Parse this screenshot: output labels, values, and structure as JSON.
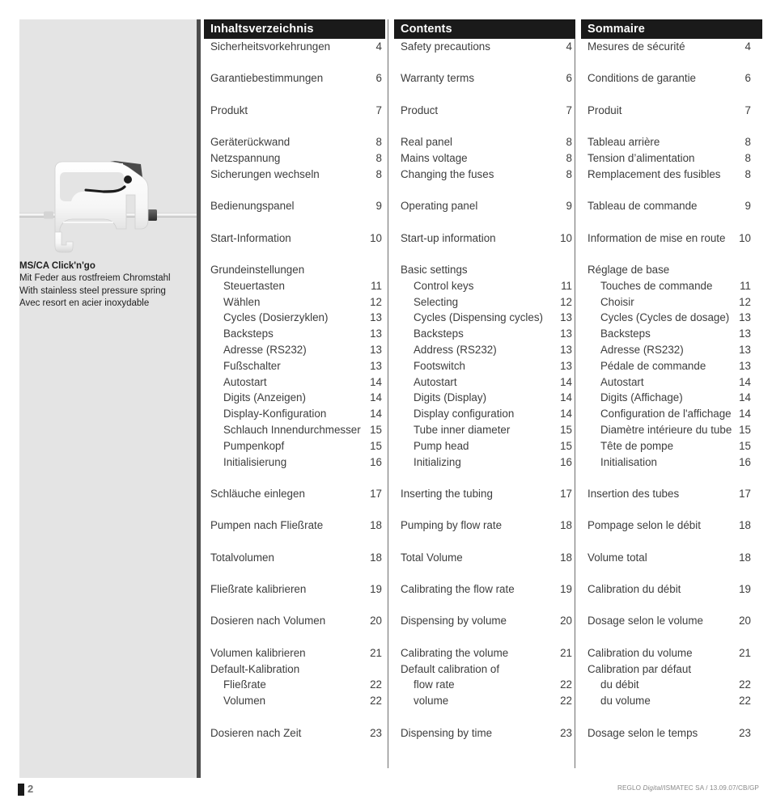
{
  "left_panel": {
    "image_alt": "ms-ca-click-n-go-cartridge",
    "caption": {
      "title": "MS/CA Click'n'go",
      "line_de": "Mit Feder aus rostfreiem Chromstahl",
      "line_en": "With stainless steel pressure spring",
      "line_fr": "Avec resort en acier inoxydable"
    }
  },
  "columns": [
    {
      "id": "de",
      "heading": "Inhaltsverzeichnis",
      "entries": [
        {
          "label": "Sicherheitsvorkehrungen",
          "page": "4",
          "sub": false,
          "gap_after": true
        },
        {
          "label": "Garantiebestimmungen",
          "page": "6",
          "sub": false,
          "gap_after": true
        },
        {
          "label": "Produkt",
          "page": "7",
          "sub": false,
          "gap_after": true
        },
        {
          "label": "Geräterückwand",
          "page": "8",
          "sub": false,
          "gap_after": false
        },
        {
          "label": "Netzspannung",
          "page": "8",
          "sub": false,
          "gap_after": false
        },
        {
          "label": "Sicherungen wechseln",
          "page": "8",
          "sub": false,
          "gap_after": true
        },
        {
          "label": "Bedienungspanel",
          "page": "9",
          "sub": false,
          "gap_after": true
        },
        {
          "label": "Start-Information",
          "page": "10",
          "sub": false,
          "gap_after": true
        },
        {
          "label": "Grundeinstellungen",
          "page": "",
          "sub": false,
          "gap_after": false
        },
        {
          "label": "Steuertasten",
          "page": "11",
          "sub": true,
          "gap_after": false
        },
        {
          "label": "Wählen",
          "page": "12",
          "sub": true,
          "gap_after": false
        },
        {
          "label": "Cycles (Dosierzyklen)",
          "page": "13",
          "sub": true,
          "gap_after": false
        },
        {
          "label": "Backsteps",
          "page": "13",
          "sub": true,
          "gap_after": false
        },
        {
          "label": "Adresse (RS232)",
          "page": "13",
          "sub": true,
          "gap_after": false
        },
        {
          "label": "Fußschalter",
          "page": "13",
          "sub": true,
          "gap_after": false
        },
        {
          "label": "Autostart",
          "page": "14",
          "sub": true,
          "gap_after": false
        },
        {
          "label": "Digits (Anzeigen)",
          "page": "14",
          "sub": true,
          "gap_after": false
        },
        {
          "label": "Display-Konfiguration",
          "page": "14",
          "sub": true,
          "gap_after": false
        },
        {
          "label": "Schlauch Innendurchmesser",
          "page": "15",
          "sub": true,
          "gap_after": false
        },
        {
          "label": "Pumpenkopf",
          "page": "15",
          "sub": true,
          "gap_after": false
        },
        {
          "label": "Initialisierung",
          "page": "16",
          "sub": true,
          "gap_after": true
        },
        {
          "label": "Schläuche einlegen",
          "page": "17",
          "sub": false,
          "gap_after": true
        },
        {
          "label": "Pumpen nach Fließrate",
          "page": "18",
          "sub": false,
          "gap_after": true
        },
        {
          "label": "Totalvolumen",
          "page": "18",
          "sub": false,
          "gap_after": true
        },
        {
          "label": "Fließrate kalibrieren",
          "page": "19",
          "sub": false,
          "gap_after": true
        },
        {
          "label": "Dosieren nach Volumen",
          "page": "20",
          "sub": false,
          "gap_after": true
        },
        {
          "label": "Volumen kalibrieren",
          "page": "21",
          "sub": false,
          "gap_after": false
        },
        {
          "label": "Default-Kalibration",
          "page": "",
          "sub": false,
          "gap_after": false
        },
        {
          "label": "Fließrate",
          "page": "22",
          "sub": true,
          "gap_after": false
        },
        {
          "label": "Volumen",
          "page": "22",
          "sub": true,
          "gap_after": true
        },
        {
          "label": "Dosieren nach Zeit",
          "page": "23",
          "sub": false,
          "gap_after": false
        }
      ]
    },
    {
      "id": "en",
      "heading": "Contents",
      "entries": [
        {
          "label": "Safety precautions",
          "page": "4",
          "sub": false,
          "gap_after": true
        },
        {
          "label": "Warranty terms",
          "page": "6",
          "sub": false,
          "gap_after": true
        },
        {
          "label": "Product",
          "page": "7",
          "sub": false,
          "gap_after": true
        },
        {
          "label": "Real panel",
          "page": "8",
          "sub": false,
          "gap_after": false
        },
        {
          "label": "Mains voltage",
          "page": "8",
          "sub": false,
          "gap_after": false
        },
        {
          "label": "Changing the fuses",
          "page": "8",
          "sub": false,
          "gap_after": true
        },
        {
          "label": "Operating panel",
          "page": "9",
          "sub": false,
          "gap_after": true
        },
        {
          "label": "Start-up information",
          "page": "10",
          "sub": false,
          "gap_after": true
        },
        {
          "label": "Basic settings",
          "page": "",
          "sub": false,
          "gap_after": false
        },
        {
          "label": "Control keys",
          "page": "11",
          "sub": true,
          "gap_after": false
        },
        {
          "label": "Selecting",
          "page": "12",
          "sub": true,
          "gap_after": false
        },
        {
          "label": "Cycles (Dispensing cycles)",
          "page": "13",
          "sub": true,
          "gap_after": false
        },
        {
          "label": "Backsteps",
          "page": "13",
          "sub": true,
          "gap_after": false
        },
        {
          "label": "Address (RS232)",
          "page": "13",
          "sub": true,
          "gap_after": false
        },
        {
          "label": "Footswitch",
          "page": "13",
          "sub": true,
          "gap_after": false
        },
        {
          "label": "Autostart",
          "page": "14",
          "sub": true,
          "gap_after": false
        },
        {
          "label": "Digits (Display)",
          "page": "14",
          "sub": true,
          "gap_after": false
        },
        {
          "label": "Display configuration",
          "page": "14",
          "sub": true,
          "gap_after": false
        },
        {
          "label": "Tube inner diameter",
          "page": "15",
          "sub": true,
          "gap_after": false
        },
        {
          "label": "Pump head",
          "page": "15",
          "sub": true,
          "gap_after": false
        },
        {
          "label": "Initializing",
          "page": "16",
          "sub": true,
          "gap_after": true
        },
        {
          "label": "Inserting the tubing",
          "page": "17",
          "sub": false,
          "gap_after": true
        },
        {
          "label": "Pumping by flow rate",
          "page": "18",
          "sub": false,
          "gap_after": true
        },
        {
          "label": "Total Volume",
          "page": "18",
          "sub": false,
          "gap_after": true
        },
        {
          "label": "Calibrating the flow rate",
          "page": "19",
          "sub": false,
          "gap_after": true
        },
        {
          "label": "Dispensing by volume",
          "page": "20",
          "sub": false,
          "gap_after": true
        },
        {
          "label": "Calibrating the volume",
          "page": "21",
          "sub": false,
          "gap_after": false
        },
        {
          "label": "Default calibration of",
          "page": "",
          "sub": false,
          "gap_after": false
        },
        {
          "label": "flow rate",
          "page": "22",
          "sub": true,
          "gap_after": false
        },
        {
          "label": "volume",
          "page": "22",
          "sub": true,
          "gap_after": true
        },
        {
          "label": "Dispensing by time",
          "page": "23",
          "sub": false,
          "gap_after": false
        }
      ]
    },
    {
      "id": "fr",
      "heading": "Sommaire",
      "entries": [
        {
          "label": "Mesures de sécurité",
          "page": "4",
          "sub": false,
          "gap_after": true
        },
        {
          "label": "Conditions de garantie",
          "page": "6",
          "sub": false,
          "gap_after": true
        },
        {
          "label": "Produit",
          "page": "7",
          "sub": false,
          "gap_after": true
        },
        {
          "label": "Tableau arrière",
          "page": "8",
          "sub": false,
          "gap_after": false
        },
        {
          "label": "Tension d’alimentation",
          "page": "8",
          "sub": false,
          "gap_after": false
        },
        {
          "label": "Remplacement des fusibles",
          "page": "8",
          "sub": false,
          "gap_after": true
        },
        {
          "label": "Tableau de commande",
          "page": "9",
          "sub": false,
          "gap_after": true
        },
        {
          "label": "Information de mise en route",
          "page": "10",
          "sub": false,
          "gap_after": true
        },
        {
          "label": "Réglage de base",
          "page": "",
          "sub": false,
          "gap_after": false
        },
        {
          "label": "Touches de commande",
          "page": "11",
          "sub": true,
          "gap_after": false
        },
        {
          "label": "Choisir",
          "page": "12",
          "sub": true,
          "gap_after": false
        },
        {
          "label": "Cycles (Cycles de dosage)",
          "page": "13",
          "sub": true,
          "gap_after": false
        },
        {
          "label": "Backsteps",
          "page": "13",
          "sub": true,
          "gap_after": false
        },
        {
          "label": "Adresse (RS232)",
          "page": "13",
          "sub": true,
          "gap_after": false
        },
        {
          "label": "Pédale de commande",
          "page": "13",
          "sub": true,
          "gap_after": false
        },
        {
          "label": "Autostart",
          "page": "14",
          "sub": true,
          "gap_after": false
        },
        {
          "label": "Digits (Affichage)",
          "page": "14",
          "sub": true,
          "gap_after": false
        },
        {
          "label": "Configuration de l'affichage",
          "page": "14",
          "sub": true,
          "gap_after": false
        },
        {
          "label": "Diamètre intérieure du tube",
          "page": "15",
          "sub": true,
          "gap_after": false
        },
        {
          "label": "Tête de pompe",
          "page": "15",
          "sub": true,
          "gap_after": false
        },
        {
          "label": "Initialisation",
          "page": "16",
          "sub": true,
          "gap_after": true
        },
        {
          "label": "Insertion des tubes",
          "page": "17",
          "sub": false,
          "gap_after": true
        },
        {
          "label": "Pompage selon le débit",
          "page": "18",
          "sub": false,
          "gap_after": true
        },
        {
          "label": "Volume total",
          "page": "18",
          "sub": false,
          "gap_after": true
        },
        {
          "label": "Calibration du débit",
          "page": "19",
          "sub": false,
          "gap_after": true
        },
        {
          "label": "Dosage selon le volume",
          "page": "20",
          "sub": false,
          "gap_after": true
        },
        {
          "label": "Calibration du volume",
          "page": "21",
          "sub": false,
          "gap_after": false
        },
        {
          "label": "Calibration par défaut",
          "page": "",
          "sub": false,
          "gap_after": false
        },
        {
          "label": "du débit",
          "page": "22",
          "sub": true,
          "gap_after": false
        },
        {
          "label": "du volume",
          "page": "22",
          "sub": true,
          "gap_after": true
        },
        {
          "label": "Dosage selon le temps",
          "page": "23",
          "sub": false,
          "gap_after": false
        }
      ]
    }
  ],
  "footer": {
    "page_number": "2",
    "imprint_prefix": "REGLO ",
    "imprint_italic": "Digital",
    "imprint_suffix": "/ISMATEC SA / 13.09.07/CB/GP"
  },
  "colors": {
    "header_bar": "#1a1a1a",
    "panel_bg": "#e4e4e4",
    "panel_rule": "#4c4c4c",
    "text": "#3d3d3d",
    "footer_text": "#8a8a8a"
  }
}
